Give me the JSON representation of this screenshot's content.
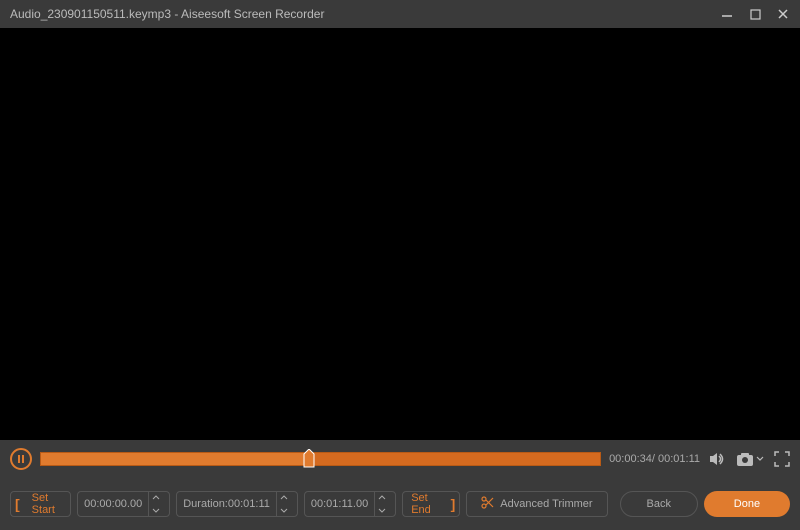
{
  "titlebar": {
    "filename": "Audio_230901150511.keymp3",
    "separator": "  -  ",
    "app_name": "Aiseesoft Screen Recorder"
  },
  "playback": {
    "current_time": "00:00:34",
    "total_time": "00:01:11",
    "time_display": "00:00:34/ 00:01:11"
  },
  "trimmer": {
    "set_start_label": "Set Start",
    "start_time": "00:00:00.00",
    "duration_label": "Duration:",
    "duration_value": "00:01:11",
    "end_time": "00:01:11.00",
    "set_end_label": "Set End",
    "advanced_label": "Advanced Trimmer",
    "back_label": "Back",
    "done_label": "Done"
  },
  "colors": {
    "accent": "#e07b2e",
    "bg_dark": "#3a3a3a",
    "bg_black": "#000000"
  }
}
